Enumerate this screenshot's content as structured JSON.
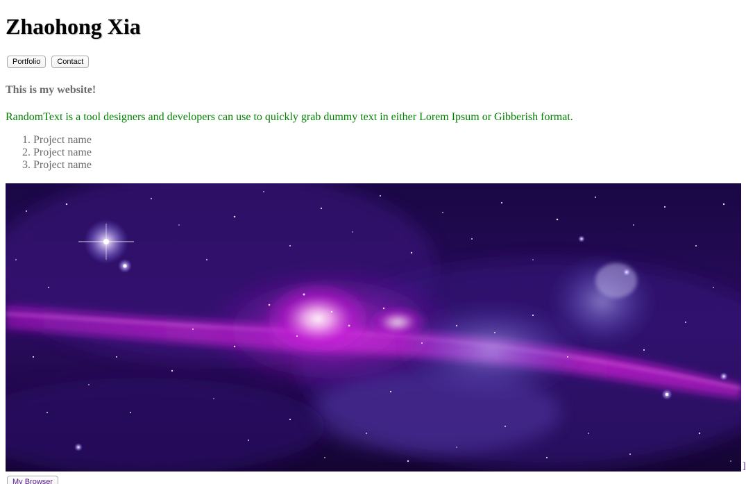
{
  "header": {
    "title": "Zhaohong Xia"
  },
  "nav": {
    "portfolio_label": "Portfolio",
    "contact_label": "Contact"
  },
  "main": {
    "subtitle": "This is my website!",
    "description": "RandomText is a tool designers and developers can use to quickly grab dummy text in either Lorem Ipsum or Gibberish format.",
    "projects": [
      "Project name",
      "Project name",
      "Project name"
    ]
  },
  "hero_image": {
    "subject": "galaxy-nebula",
    "colors": {
      "space_dark": "#140533",
      "magenta": "#c21bd6",
      "violet": "#6a2fb0",
      "core_glow": "#f7c9f4"
    }
  },
  "footer": {
    "stray_text": "]",
    "browser_button_label": "My Browser"
  },
  "colors": {
    "title": "#000000",
    "subtitle": "#6b6b6b",
    "description": "#008000",
    "list": "#6b6b6b",
    "link_visited": "#551a8b"
  }
}
